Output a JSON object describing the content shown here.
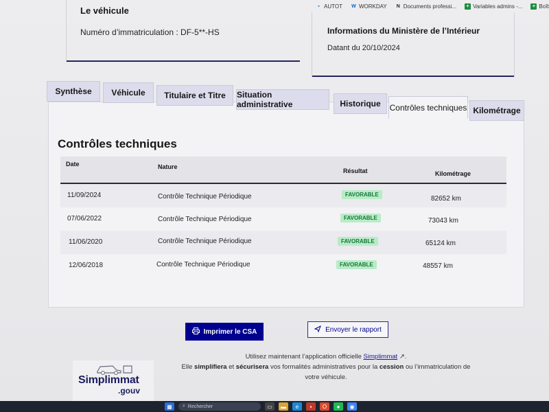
{
  "bookmarks": [
    {
      "icon": "app-icon",
      "label": "AUTOT",
      "color": "#2b6cb0"
    },
    {
      "icon": "workday-icon",
      "label": "WORKDAY",
      "color": "#0a66c2"
    },
    {
      "icon": "notion-icon",
      "label": "Documents professi...",
      "color": "#222222"
    },
    {
      "icon": "sheets-icon",
      "label": "Variables admins -...",
      "color": "#1e8e3e"
    },
    {
      "icon": "sheets-icon",
      "label": "Boîte à ou",
      "color": "#1e8e3e"
    }
  ],
  "vehicle_card": {
    "title": "Le véhicule",
    "registration": "Numéro d’immatriculation : DF-5**-HS"
  },
  "ministry_card": {
    "title": "Informations du Ministère de l’Intérieur",
    "date": "Datant du 20/10/2024"
  },
  "tabs": [
    {
      "label": "Synthèse",
      "active": false
    },
    {
      "label": "Véhicule",
      "active": false
    },
    {
      "label": "Titulaire et Titre",
      "active": false
    },
    {
      "label": "Situation administrative",
      "active": false
    },
    {
      "label": "Historique",
      "active": false
    },
    {
      "label": "Contrôles techniques",
      "active": true
    },
    {
      "label": "Kilométrage",
      "active": false
    }
  ],
  "section": {
    "title": "Contrôles techniques",
    "columns": {
      "date": "Date",
      "nature": "Nature",
      "result": "Résultat",
      "mileage": "Kilométrage"
    },
    "rows": [
      {
        "date": "11/09/2024",
        "nature": "Contrôle Technique Périodique",
        "result": "FAVORABLE",
        "mileage": "82652 km"
      },
      {
        "date": "07/06/2022",
        "nature": "Contrôle Technique Périodique",
        "result": "FAVORABLE",
        "mileage": "73043 km"
      },
      {
        "date": "11/06/2020",
        "nature": "Contrôle Technique Périodique",
        "result": "FAVORABLE",
        "mileage": "65124 km"
      },
      {
        "date": "12/06/2018",
        "nature": "Contrôle Technique Périodique",
        "result": "FAVORABLE",
        "mileage": "48557 km"
      }
    ]
  },
  "actions": {
    "print": "Imprimer le CSA",
    "send": "Envoyer le rapport"
  },
  "footer": {
    "logo_main": "Simplimmat",
    "logo_sub": ".gouv",
    "promo_prefix": "Utilisez maintenant l’application officielle",
    "promo_link": "Simplimmat",
    "promo_l2_a": "Elle",
    "promo_l2_b": "simplifiera",
    "promo_l2_c": "et",
    "promo_l2_d": "sécurisera",
    "promo_l2_e": "vos formalités administratives pour la",
    "promo_l2_f": "cession",
    "promo_l2_g": "ou l’immatriculation de",
    "promo_l3": "votre véhicule."
  },
  "taskbar": {
    "search_placeholder": "Rechercher"
  },
  "colors": {
    "primary": "#00008f",
    "success_bg": "#b8ecc6",
    "success_text": "#18753c"
  }
}
